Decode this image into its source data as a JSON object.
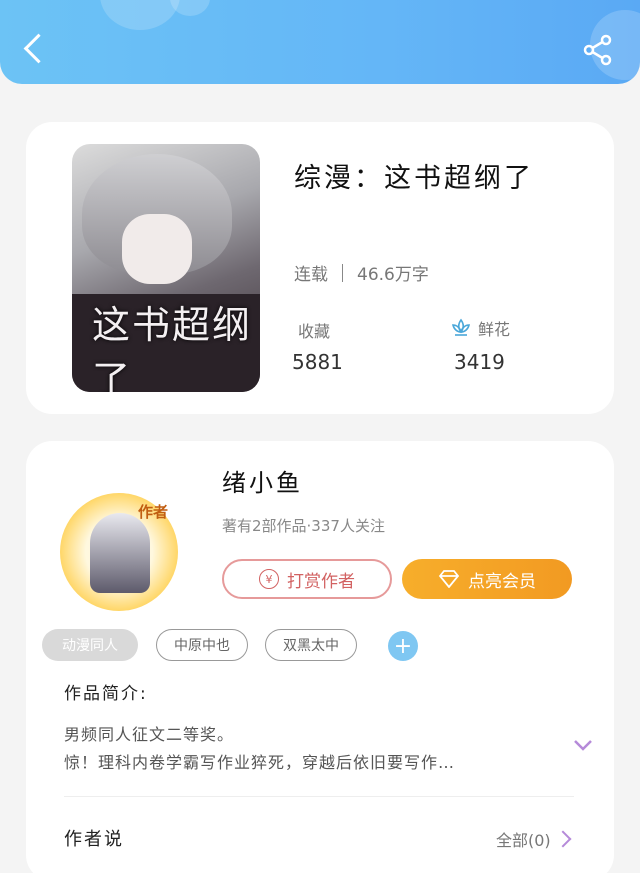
{
  "header": {
    "back_icon": "chevron-left-icon",
    "share_icon": "share-icon"
  },
  "book": {
    "title": "综漫：这书超纲了",
    "cover_text": "这书超纲了",
    "status": "连载",
    "word_count": "46.6万字",
    "collect_label": "收藏",
    "collect_value": "5881",
    "flower_label": "鲜花",
    "flower_value": "3419"
  },
  "author": {
    "name": "绪小鱼",
    "avatar_tag": "作者",
    "meta": "著有2部作品·337人关注",
    "tip_label": "打赏作者",
    "tip_icon_text": "¥",
    "vip_label": "点亮会员"
  },
  "tags": [
    "动漫同人",
    "中原中也",
    "双黑太中"
  ],
  "intro": {
    "label": "作品简介:",
    "line1": "男频同人征文二等奖。",
    "line2": "惊！理科内卷学霸写作业猝死，穿越后依旧要写作…"
  },
  "author_say": {
    "label": "作者说",
    "all_link": "全部(0)"
  },
  "colors": {
    "header": "#64b6f7",
    "vip": "#f29a22",
    "tip": "#d26262",
    "accent": "#b58ad9"
  }
}
